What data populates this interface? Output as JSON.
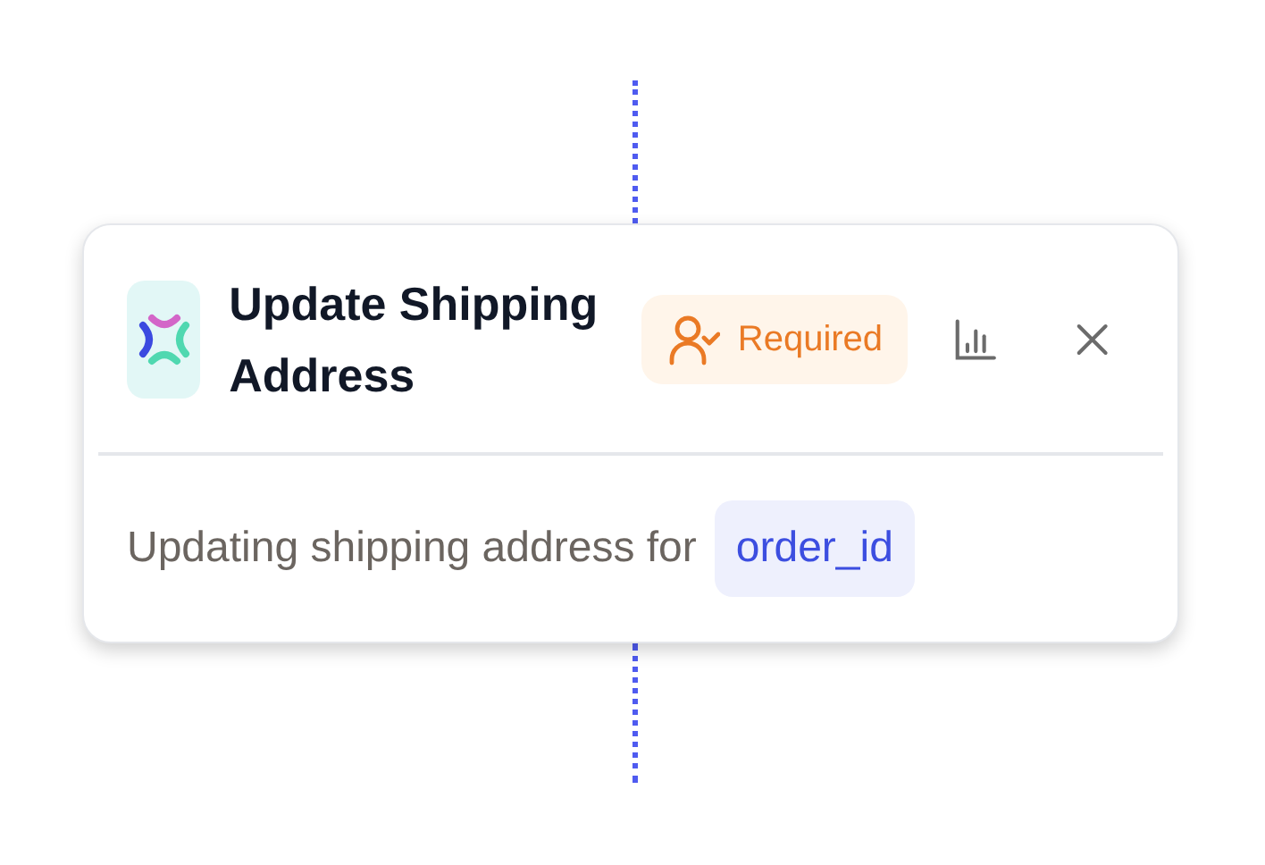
{
  "node": {
    "title": "Update Shipping Address",
    "badge": {
      "label": "Required"
    },
    "message": {
      "text": "Updating shipping address for",
      "variable": "order_id"
    }
  }
}
